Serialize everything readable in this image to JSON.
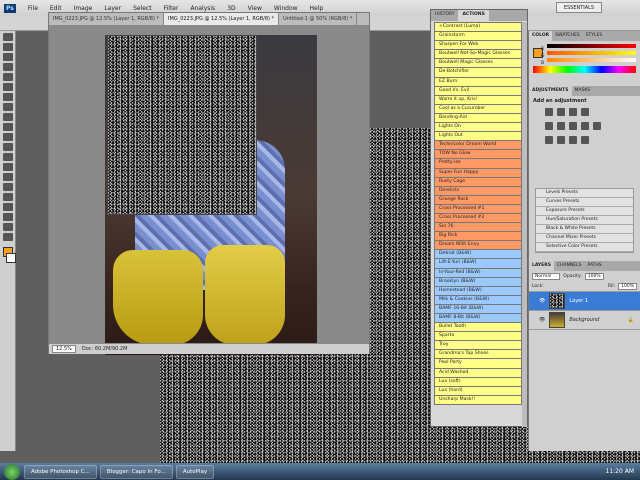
{
  "menubar": {
    "app_badge": "Ps",
    "items": [
      "File",
      "Edit",
      "Image",
      "Layer",
      "Select",
      "Filter",
      "Analysis",
      "3D",
      "View",
      "Window",
      "Help"
    ]
  },
  "workspace": {
    "essentials": "ESSENTIALS"
  },
  "document": {
    "tabs": [
      {
        "label": "IMG_0223.JPG @ 12.5% (Layer 1, RGB/8) *",
        "active": false
      },
      {
        "label": "IMG_0223.JPG @ 12.5% (Layer 1, RGB/8) *",
        "active": true
      },
      {
        "label": "Untitled-1 @ 50% (RGB/8) *",
        "active": false
      }
    ],
    "zoom": "12.5%",
    "doc_size": "Doc: 60.2M/90.2M"
  },
  "actions_panel": {
    "tabs": [
      "HISTORY",
      "ACTIONS"
    ],
    "items": [
      {
        "label": "+Contrast (Luma)",
        "c": "y"
      },
      {
        "label": "Grainstorm",
        "c": "y"
      },
      {
        "label": "Sharpen For Web",
        "c": "y"
      },
      {
        "label": "Boutwell Not-So-Magic Glasses",
        "c": "y"
      },
      {
        "label": "Boutwell Magic Glasses",
        "c": "y"
      },
      {
        "label": "De-Botchifier",
        "c": "y"
      },
      {
        "label": "EZ Burn",
        "c": "y"
      },
      {
        "label": "Good Vs. Evil",
        "c": "y"
      },
      {
        "label": "Warm it up, Kris!",
        "c": "y"
      },
      {
        "label": "Cool as a Cucumber",
        "c": "y"
      },
      {
        "label": "Banding-Aid",
        "c": "y"
      },
      {
        "label": "Lights On",
        "c": "y"
      },
      {
        "label": "Lights Out",
        "c": "y"
      },
      {
        "label": "Technicolor Dream World",
        "c": "o"
      },
      {
        "label": "TOW No Glow",
        "c": "o"
      },
      {
        "label": "Pretty-ize",
        "c": "o"
      },
      {
        "label": "Super Fun Happy",
        "c": "o"
      },
      {
        "label": "Rusty Cage",
        "c": "o"
      },
      {
        "label": "Derelicts",
        "c": "o"
      },
      {
        "label": "Grunge Rock",
        "c": "o"
      },
      {
        "label": "Cross Processed #1",
        "c": "o"
      },
      {
        "label": "Cross Processed #2",
        "c": "o"
      },
      {
        "label": "Sin 76",
        "c": "o"
      },
      {
        "label": "Big Rick",
        "c": "o"
      },
      {
        "label": "Dream With Envy",
        "c": "o"
      },
      {
        "label": "Detroit (B&W)",
        "c": "b"
      },
      {
        "label": "Lift-E-Yuri (B&W)",
        "c": "b"
      },
      {
        "label": "In-Your-Red (B&W)",
        "c": "b"
      },
      {
        "label": "Brooklyn (B&W)",
        "c": "b"
      },
      {
        "label": "Homestead (B&W)",
        "c": "b"
      },
      {
        "label": "Milk & Cookies (B&W)",
        "c": "b"
      },
      {
        "label": "BAMF 16-Bit (B&W)",
        "c": "b"
      },
      {
        "label": "BAMF 8-Bit (B&W)",
        "c": "b"
      },
      {
        "label": "Bullet Tooth",
        "c": "y"
      },
      {
        "label": "Sparta",
        "c": "y"
      },
      {
        "label": "Troy",
        "c": "y"
      },
      {
        "label": "Grandma's Tap Shoes",
        "c": "y"
      },
      {
        "label": "Pool Party",
        "c": "y"
      },
      {
        "label": "Acid Washed",
        "c": "y"
      },
      {
        "label": "Lux (soft)",
        "c": "y"
      },
      {
        "label": "Lux (hard)",
        "c": "y"
      },
      {
        "label": "Unsharp Mask!!",
        "c": "y"
      }
    ]
  },
  "color_panel": {
    "tabs": [
      "COLOR",
      "SWATCHES",
      "STYLES"
    ],
    "channels": [
      "R",
      "G",
      "B"
    ]
  },
  "adjustments_panel": {
    "tabs": [
      "ADJUSTMENTS",
      "MASKS"
    ],
    "title": "Add an adjustment",
    "presets": [
      "Levels Presets",
      "Curves Presets",
      "Exposure Presets",
      "Hue/Saturation Presets",
      "Black & White Presets",
      "Channel Mixer Presets",
      "Selective Color Presets"
    ]
  },
  "layers_panel": {
    "tabs": [
      "LAYERS",
      "CHANNELS",
      "PATHS"
    ],
    "blend_mode": "Normal",
    "opacity_label": "Opacity:",
    "opacity": "100%",
    "lock_label": "Lock:",
    "fill_label": "Fill:",
    "fill": "100%",
    "layers": [
      {
        "name": "Layer 1",
        "selected": true
      },
      {
        "name": "Background",
        "selected": false
      }
    ]
  },
  "taskbar": {
    "tasks": [
      "Adobe Photoshop C...",
      "Blogger: Capo In Fo...",
      "AutoPlay"
    ],
    "clock": "11:20 AM"
  }
}
